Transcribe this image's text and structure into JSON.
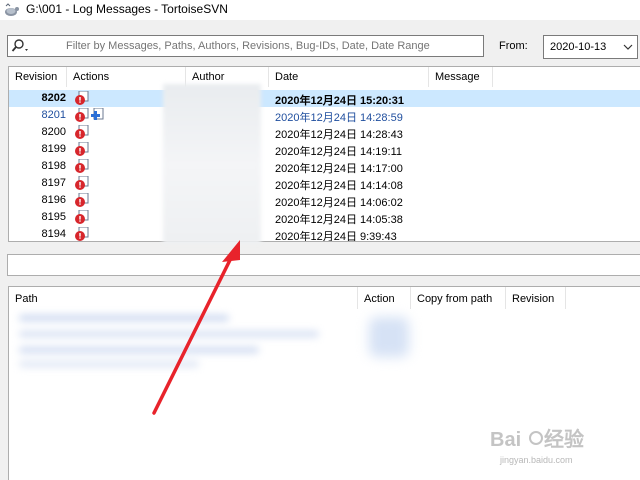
{
  "window": {
    "title": "G:\\001 - Log Messages - TortoiseSVN"
  },
  "filter": {
    "placeholder": "Filter by Messages, Paths, Authors, Revisions, Bug-IDs, Date, Date Range",
    "from_label": "From:",
    "from_value": "2020-10-13"
  },
  "log_list": {
    "columns": [
      "Revision",
      "Actions",
      "Author",
      "Date",
      "Message"
    ],
    "rows": [
      {
        "revision": "8202",
        "actions": [
          "modified-icon"
        ],
        "date": "2020年12月24日 15:20:31",
        "style": "bold"
      },
      {
        "revision": "8201",
        "actions": [
          "modified-icon",
          "added-icon"
        ],
        "date": "2020年12月24日 14:28:59",
        "style": "blue"
      },
      {
        "revision": "8200",
        "actions": [
          "modified-icon"
        ],
        "date": "2020年12月24日 14:28:43",
        "style": ""
      },
      {
        "revision": "8199",
        "actions": [
          "modified-icon"
        ],
        "date": "2020年12月24日 14:19:11",
        "style": ""
      },
      {
        "revision": "8198",
        "actions": [
          "modified-icon"
        ],
        "date": "2020年12月24日 14:17:00",
        "style": ""
      },
      {
        "revision": "8197",
        "actions": [
          "modified-icon"
        ],
        "date": "2020年12月24日 14:14:08",
        "style": ""
      },
      {
        "revision": "8196",
        "actions": [
          "modified-icon"
        ],
        "date": "2020年12月24日 14:06:02",
        "style": ""
      },
      {
        "revision": "8195",
        "actions": [
          "modified-icon"
        ],
        "date": "2020年12月24日 14:05:38",
        "style": ""
      },
      {
        "revision": "8194",
        "actions": [
          "modified-icon"
        ],
        "date": "2020年12月24日 9:39:43",
        "style": ""
      }
    ]
  },
  "path_list": {
    "columns": [
      "Path",
      "Action",
      "Copy from path",
      "Revision"
    ]
  },
  "watermark": {
    "url": "jingyan.baidu.com"
  },
  "colors": {
    "selection": "#cce8ff",
    "blue_text": "#1f4e9e",
    "arrow": "#e8232b"
  }
}
